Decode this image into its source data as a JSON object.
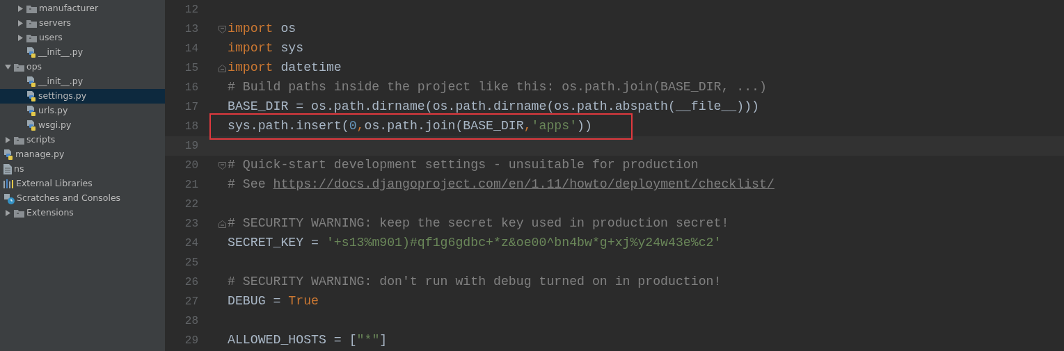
{
  "project_tree": [
    {
      "kind": "continued",
      "children": [
        {
          "kind": "folder",
          "label": "manufacturer",
          "expanded": false,
          "selected": false
        },
        {
          "kind": "folder",
          "label": "servers",
          "expanded": false,
          "selected": false
        },
        {
          "kind": "folder",
          "label": "users",
          "expanded": false,
          "selected": false
        },
        {
          "kind": "python",
          "label": "__init__.py",
          "selected": false
        }
      ]
    },
    {
      "kind": "folder",
      "label": "ops",
      "expanded": true,
      "selected": false,
      "children": [
        {
          "kind": "python",
          "label": "__init__.py",
          "selected": false
        },
        {
          "kind": "python",
          "label": "settings.py",
          "selected": true
        },
        {
          "kind": "python",
          "label": "urls.py",
          "selected": false
        },
        {
          "kind": "python",
          "label": "wsgi.py",
          "selected": false
        }
      ]
    },
    {
      "kind": "folder",
      "label": "scripts",
      "expanded": false,
      "selected": false
    },
    {
      "kind": "python",
      "label": "manage.py",
      "selected": false
    },
    {
      "kind": "file",
      "label": "ns",
      "selected": false
    },
    {
      "kind": "libraries",
      "label": "External Libraries",
      "selected": false
    },
    {
      "kind": "scratches",
      "label": "Scratches and Consoles",
      "selected": false
    },
    {
      "kind": "folder",
      "label": "Extensions",
      "expanded": false,
      "selected": false
    }
  ],
  "editor": {
    "lines": [
      {
        "number": "12"
      },
      {
        "number": "13",
        "fold_start": true,
        "tokens": [
          {
            "kind": "keyword",
            "text": "import"
          },
          {
            "kind": "plain",
            "text": " os"
          }
        ]
      },
      {
        "number": "14",
        "tokens": [
          {
            "kind": "keyword",
            "text": "import"
          },
          {
            "kind": "plain",
            "text": " sys"
          }
        ]
      },
      {
        "number": "15",
        "fold_end": true,
        "tokens": [
          {
            "kind": "keyword",
            "text": "import"
          },
          {
            "kind": "plain",
            "text": " datetime"
          }
        ]
      },
      {
        "number": "16",
        "tokens": [
          {
            "kind": "comment",
            "text": "# Build paths inside the project like this: os.path.join(BASE_DIR, ...)"
          }
        ]
      },
      {
        "number": "17",
        "tokens": [
          {
            "kind": "plain",
            "text": "BASE_DIR = os.path.dirname(os.path.dirname(os.path.abspath(__file__)))"
          }
        ]
      },
      {
        "number": "18",
        "highlighted": true,
        "tokens": [
          {
            "kind": "plain",
            "text": "sys.path.insert("
          },
          {
            "kind": "number",
            "text": "0"
          },
          {
            "kind": "keyword",
            "text": ","
          },
          {
            "kind": "plain",
            "text": "os.path.join(BASE_DIR"
          },
          {
            "kind": "keyword",
            "text": ","
          },
          {
            "kind": "string",
            "text": "'apps'"
          },
          {
            "kind": "plain",
            "text": "))"
          }
        ]
      },
      {
        "number": "19",
        "current": true
      },
      {
        "number": "20",
        "fold_start": true,
        "tokens": [
          {
            "kind": "comment",
            "text": "# Quick-start development settings - unsuitable for production"
          }
        ]
      },
      {
        "number": "21",
        "tokens": [
          {
            "kind": "comment",
            "text": "# See "
          },
          {
            "kind": "link",
            "text": "https://docs.djangoproject.com/en/1.11/howto/deployment/checklist/"
          }
        ]
      },
      {
        "number": "22"
      },
      {
        "number": "23",
        "fold_end": true,
        "tokens": [
          {
            "kind": "comment",
            "text": "# SECURITY WARNING: keep the secret key used in production secret!"
          }
        ]
      },
      {
        "number": "24",
        "tokens": [
          {
            "kind": "plain",
            "text": "SECRET_KEY = "
          },
          {
            "kind": "string",
            "text": "'+s13%m901)#qf1g6gdbc+*z&oe00^bn4bw*g+xj%y24w43e%c2'"
          }
        ]
      },
      {
        "number": "25"
      },
      {
        "number": "26",
        "tokens": [
          {
            "kind": "comment",
            "text": "# SECURITY WARNING: don't run with debug turned on in production!"
          }
        ]
      },
      {
        "number": "27",
        "tokens": [
          {
            "kind": "plain",
            "text": "DEBUG = "
          },
          {
            "kind": "keyword",
            "text": "True"
          }
        ]
      },
      {
        "number": "28"
      },
      {
        "number": "29",
        "tokens": [
          {
            "kind": "plain",
            "text": "ALLOWED_HOSTS = ["
          },
          {
            "kind": "string",
            "text": "\"*\""
          },
          {
            "kind": "plain",
            "text": "]"
          }
        ]
      }
    ]
  }
}
